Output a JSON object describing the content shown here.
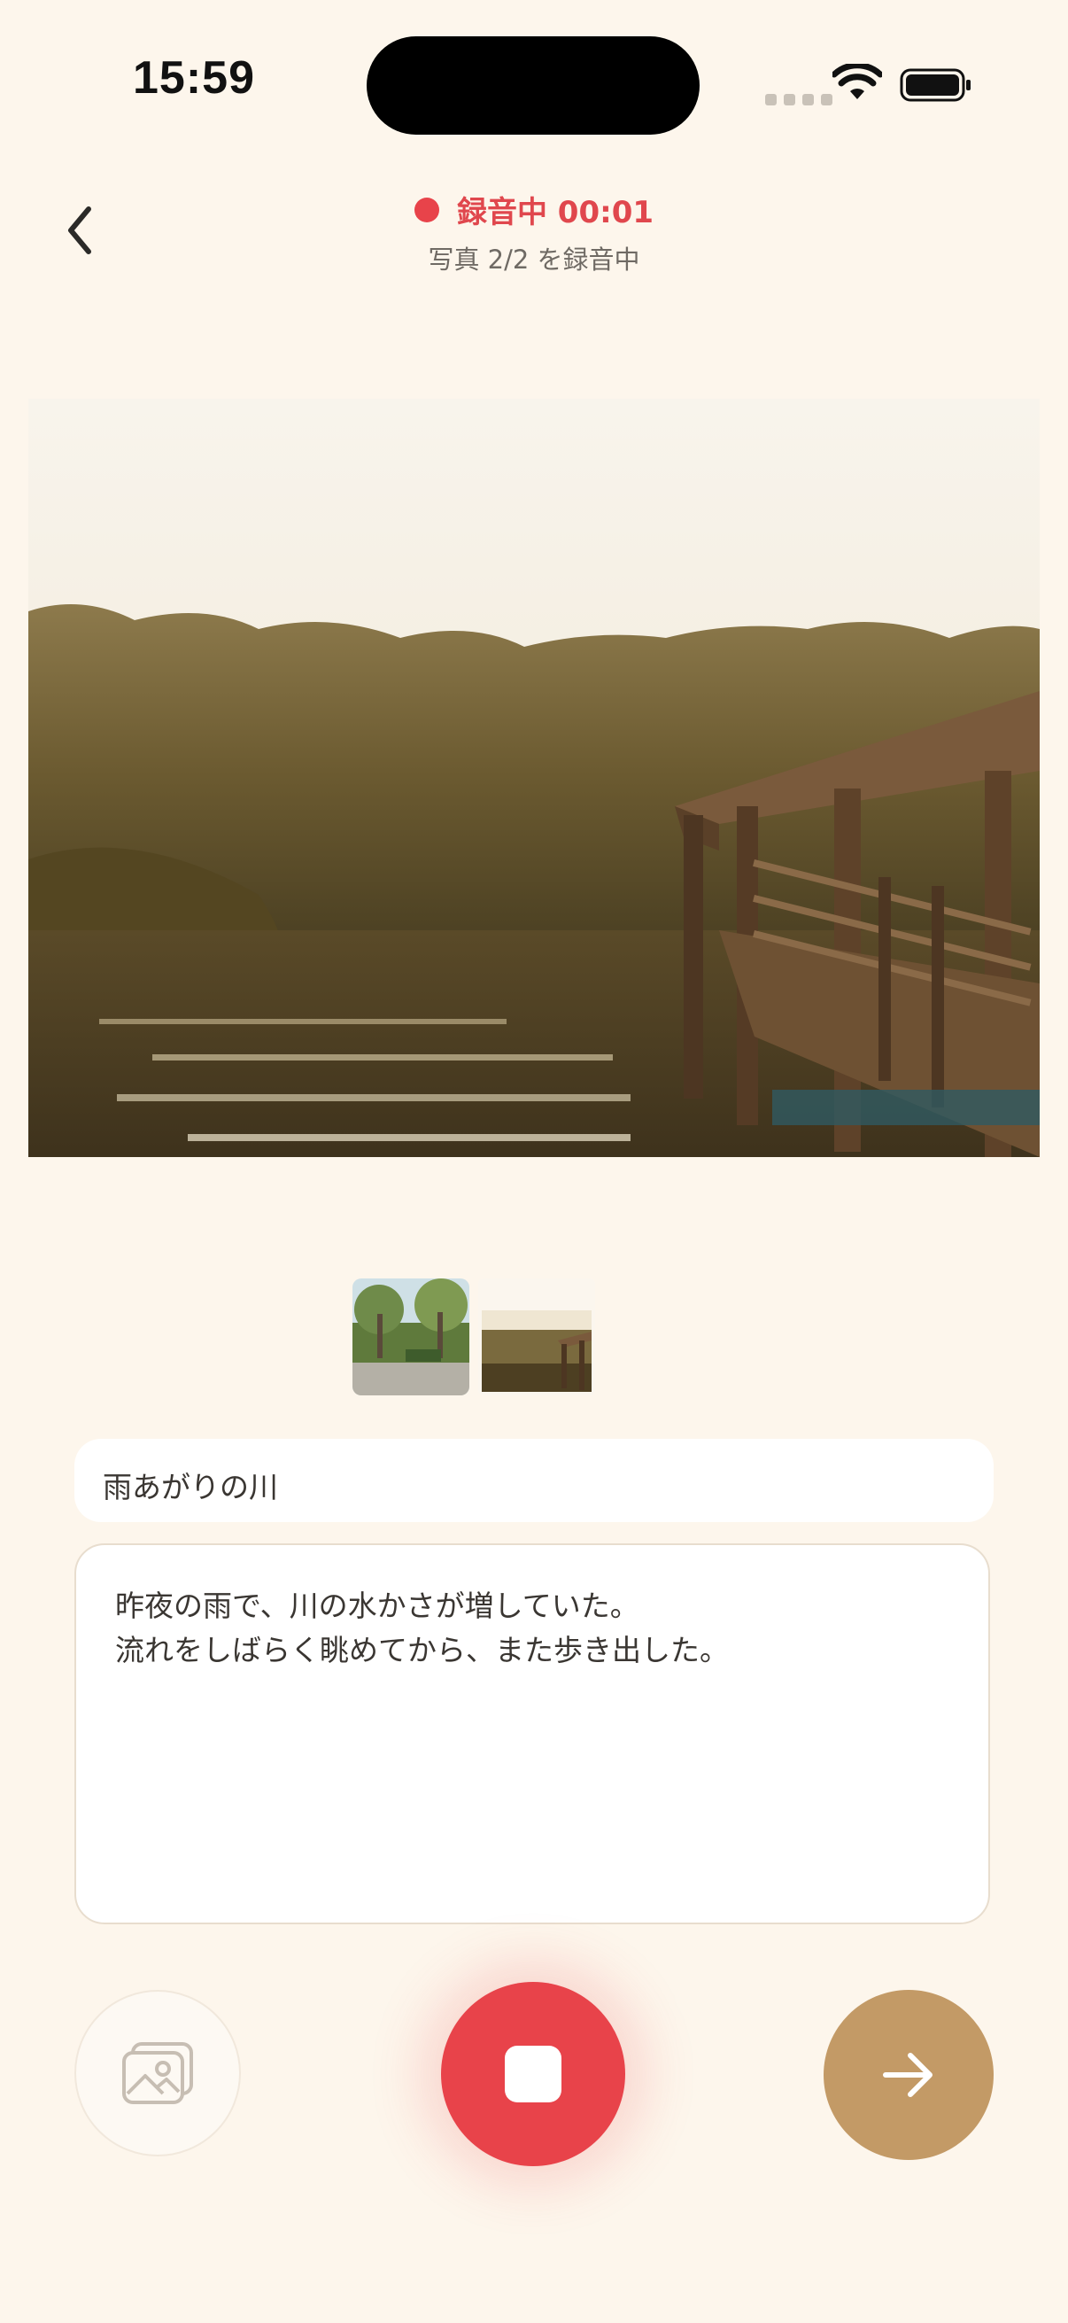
{
  "status_bar": {
    "time": "15:59"
  },
  "header": {
    "recording_label": "録音中 00:01",
    "subtitle": "写真 2/2 を録音中",
    "accent_color": "#e8434a"
  },
  "photos": {
    "thumbnails": [
      "park-photo",
      "river-pier-photo"
    ],
    "selected_index": 1
  },
  "form": {
    "title_value": "雨あがりの川",
    "memo_lines": [
      "昨夜の雨で、川の水かさが増していた。",
      "流れをしばらく眺めてから、また歩き出した。"
    ]
  },
  "controls": {
    "gallery_icon": "gallery-icon",
    "stop_icon": "stop-icon",
    "next_icon": "arrow-right-icon",
    "next_color": "#c39a66"
  }
}
